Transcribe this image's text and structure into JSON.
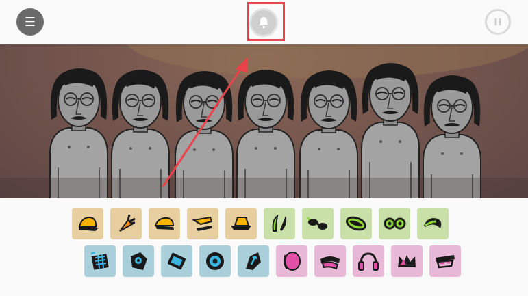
{
  "topbar": {
    "menu_icon": "menu-icon",
    "center_icon": "bell-icon",
    "right_icon": "pause-icon",
    "menu_glyph": "☰"
  },
  "colors": {
    "stage_bg": "#6b4f4a",
    "beat": "#e8cfa0",
    "effect": "#c9e1a8",
    "melody": "#a9cfda",
    "voice": "#e7b9d6",
    "annotation": "#e8424a"
  },
  "stage": {
    "character_count": 7
  },
  "sound_icons": {
    "row1": [
      {
        "name": "beat-cap-icon",
        "group": "beat"
      },
      {
        "name": "beat-carrot-icon",
        "group": "beat"
      },
      {
        "name": "beat-cap-side-icon",
        "group": "beat"
      },
      {
        "name": "beat-visor-icon",
        "group": "beat"
      },
      {
        "name": "beat-hat-icon",
        "group": "beat"
      },
      {
        "name": "effect-sticks-icon",
        "group": "effect"
      },
      {
        "name": "effect-sunglasses-icon",
        "group": "effect"
      },
      {
        "name": "effect-disc-icon",
        "group": "effect"
      },
      {
        "name": "effect-glasses-icon",
        "group": "effect"
      },
      {
        "name": "effect-leaf-icon",
        "group": "effect"
      }
    ],
    "row2": [
      {
        "name": "melody-grid-icon",
        "group": "melody"
      },
      {
        "name": "melody-box-icon",
        "group": "melody"
      },
      {
        "name": "melody-tablet-icon",
        "group": "melody"
      },
      {
        "name": "melody-target-icon",
        "group": "melody"
      },
      {
        "name": "melody-arrow-icon",
        "group": "melody"
      },
      {
        "name": "voice-mic-icon",
        "group": "voice"
      },
      {
        "name": "voice-hat-icon",
        "group": "voice"
      },
      {
        "name": "voice-headphones-icon",
        "group": "voice"
      },
      {
        "name": "voice-crown-icon",
        "group": "voice"
      },
      {
        "name": "voice-mask-icon",
        "group": "voice"
      }
    ]
  }
}
